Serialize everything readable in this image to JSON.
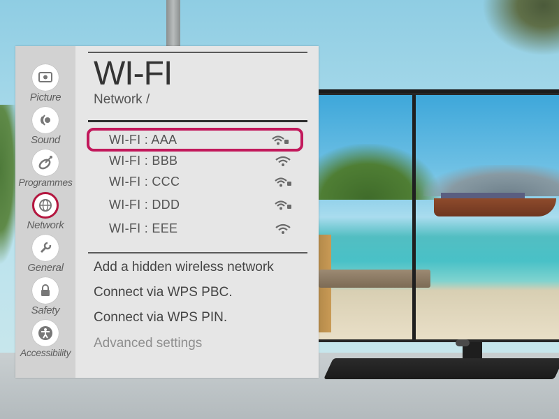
{
  "sidebar": {
    "items": [
      {
        "label": "Picture",
        "icon": "picture-icon"
      },
      {
        "label": "Sound",
        "icon": "sound-icon"
      },
      {
        "label": "Programmes",
        "icon": "programmes-icon"
      },
      {
        "label": "Network",
        "icon": "network-icon",
        "active": true
      },
      {
        "label": "General",
        "icon": "general-icon"
      },
      {
        "label": "Safety",
        "icon": "lock-icon"
      },
      {
        "label": "Accessibility",
        "icon": "accessibility-icon"
      }
    ]
  },
  "header": {
    "title": "WI-FI",
    "breadcrumb": "Network /"
  },
  "networks": [
    {
      "name": "WI-FI : AAA",
      "secured": true,
      "selected": true
    },
    {
      "name": "WI-FI : BBB",
      "secured": false
    },
    {
      "name": "WI-FI : CCC",
      "secured": true
    },
    {
      "name": "WI-FI : DDD",
      "secured": true
    },
    {
      "name": "WI-FI : EEE",
      "secured": false
    }
  ],
  "options": {
    "hidden_network": "Add a hidden wireless network",
    "wps_pbc": "Connect via WPS PBC.",
    "wps_pin": "Connect via WPS PIN.",
    "advanced": "Advanced settings"
  },
  "colors": {
    "highlight": "#c2185b",
    "panel_bg": "#e6e6e6",
    "sidebar_bg": "#d2d2d2"
  }
}
